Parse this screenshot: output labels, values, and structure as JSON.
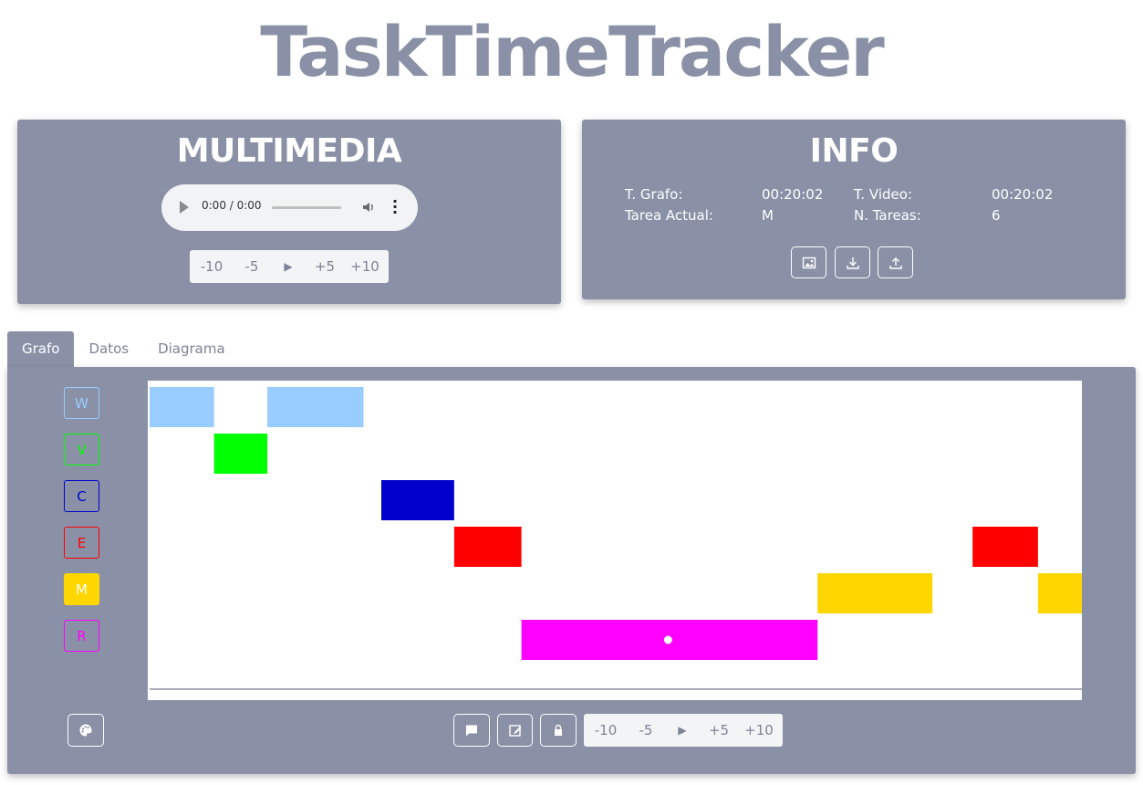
{
  "app": {
    "title": "TaskTimeTracker"
  },
  "multimedia": {
    "title": "MULTIMEDIA",
    "audio": {
      "time": "0:00 / 0:00"
    },
    "stepper": [
      "-10",
      "-5",
      "▶",
      "+5",
      "+10"
    ]
  },
  "info": {
    "title": "INFO",
    "rows": [
      {
        "label1": "T. Grafo:",
        "value1": "00:20:02",
        "label2": "T. Video:",
        "value2": "00:20:02"
      },
      {
        "label1": "Tarea Actual:",
        "value1": "M",
        "label2": "N. Tareas:",
        "value2": "6"
      }
    ],
    "buttons": [
      "image-icon",
      "download-icon",
      "upload-icon"
    ]
  },
  "tabs": [
    "Grafo",
    "Datos",
    "Diagrama"
  ],
  "legend": [
    {
      "label": "W",
      "color": "#99ccff"
    },
    {
      "label": "V",
      "color": "#00ff00"
    },
    {
      "label": "C",
      "color": "#0000cc"
    },
    {
      "label": "E",
      "color": "#ff0000"
    },
    {
      "label": "M",
      "color": "#ffd600"
    },
    {
      "label": "R",
      "color": "#ff00ff"
    }
  ],
  "chart_data": {
    "type": "gantt",
    "total_time": "00:20:02",
    "tasks": [
      "W",
      "V",
      "C",
      "E",
      "M",
      "R"
    ],
    "colors": {
      "W": "#99ccff",
      "V": "#00ff00",
      "C": "#0000cc",
      "E": "#ff0000",
      "M": "#ffd600",
      "R": "#ff00ff"
    },
    "segments": [
      {
        "task": "W",
        "start": 0.002,
        "end": 0.071
      },
      {
        "task": "V",
        "start": 0.071,
        "end": 0.128
      },
      {
        "task": "W",
        "start": 0.128,
        "end": 0.231
      },
      {
        "task": "C",
        "start": 0.25,
        "end": 0.328
      },
      {
        "task": "E",
        "start": 0.328,
        "end": 0.4
      },
      {
        "task": "R",
        "start": 0.4,
        "end": 0.717
      },
      {
        "task": "M",
        "start": 0.717,
        "end": 0.84
      },
      {
        "task": "E",
        "start": 0.883,
        "end": 0.953
      },
      {
        "task": "M",
        "start": 0.953,
        "end": 1.0
      }
    ],
    "cursor": {
      "task": "R",
      "position": 0.557
    }
  },
  "graph_toolbar": {
    "buttons": [
      "comment-icon",
      "edit-icon",
      "lock-icon"
    ],
    "stepper": [
      "-10",
      "-5",
      "▶",
      "+5",
      "+10"
    ],
    "palette": "palette-icon"
  }
}
